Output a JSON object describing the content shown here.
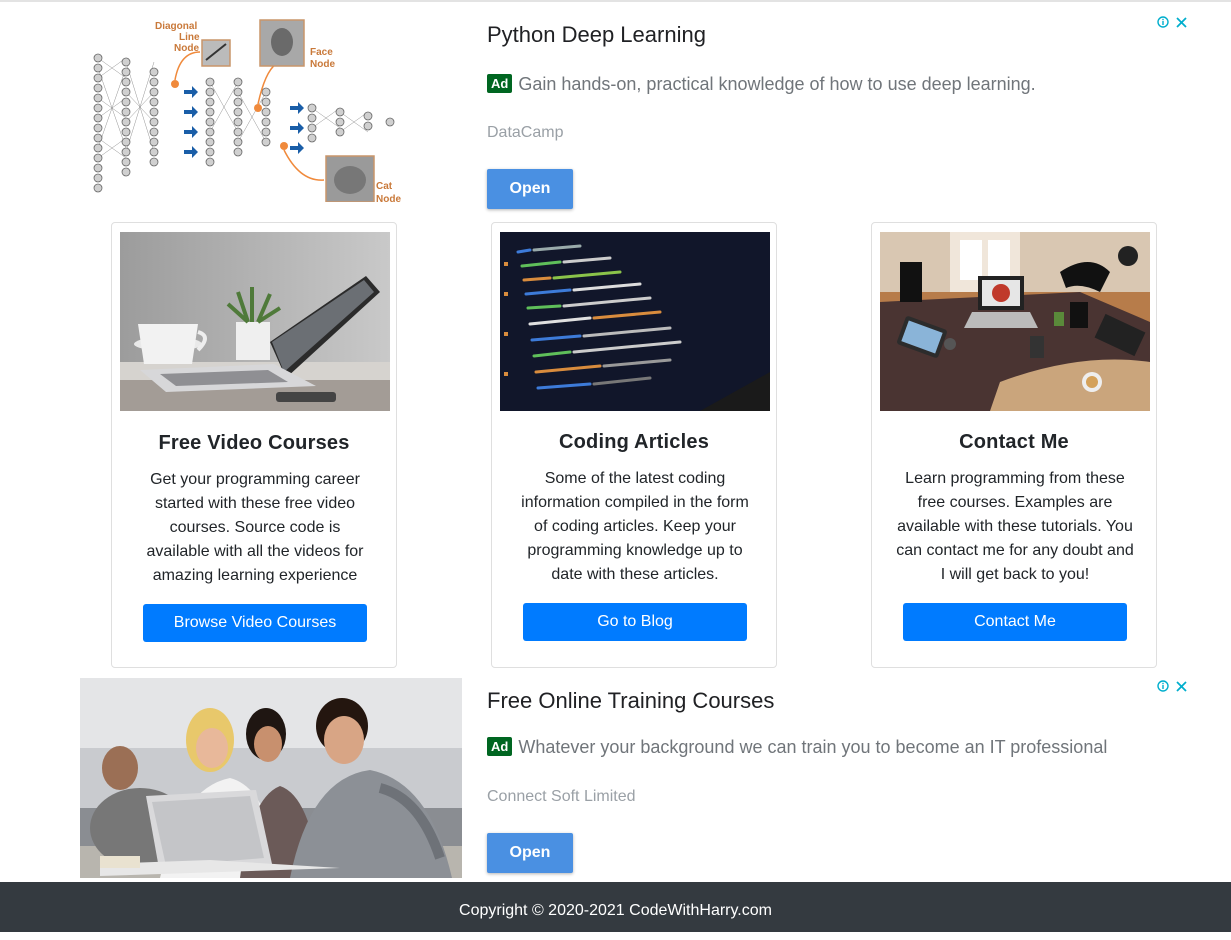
{
  "ad_top": {
    "title": "Python Deep Learning",
    "ad_label": "Ad",
    "description": "Gain hands-on, practical knowledge of how to use deep learning.",
    "advertiser": "DataCamp",
    "button": "Open",
    "image_labels": {
      "diagonal": "Diagonal Line Node",
      "face": "Face Node",
      "cat": "Cat Node"
    }
  },
  "cards": [
    {
      "title": "Free Video Courses",
      "text": "Get your programming career started with these free video courses. Source code is available with all the videos for amazing learning experience",
      "button": "Browse Video Courses"
    },
    {
      "title": "Coding Articles",
      "text": "Some of the latest coding information compiled in the form of coding articles. Keep your programming knowledge up to date with these articles.",
      "button": "Go to Blog"
    },
    {
      "title": "Contact Me",
      "text": "Learn programming from these free courses. Examples are available with these tutorials. You can contact me for any doubt and I will get back to you!",
      "button": "Contact Me"
    }
  ],
  "ad_bottom": {
    "title": "Free Online Training Courses",
    "ad_label": "Ad",
    "description": "Whatever your background we can train you to become an IT professional",
    "advertiser": "Connect Soft Limited",
    "button": "Open"
  },
  "footer": {
    "copyright": "Copyright © 2020-2021 CodeWithHarry.com"
  },
  "colors": {
    "primary": "#007bff",
    "ad_open": "#4a90e2",
    "ad_green": "#006621",
    "footer_bg": "#343a40",
    "adchoice": "#00aecd"
  },
  "icons": {
    "adchoice": "info-icon",
    "close": "close-icon"
  }
}
